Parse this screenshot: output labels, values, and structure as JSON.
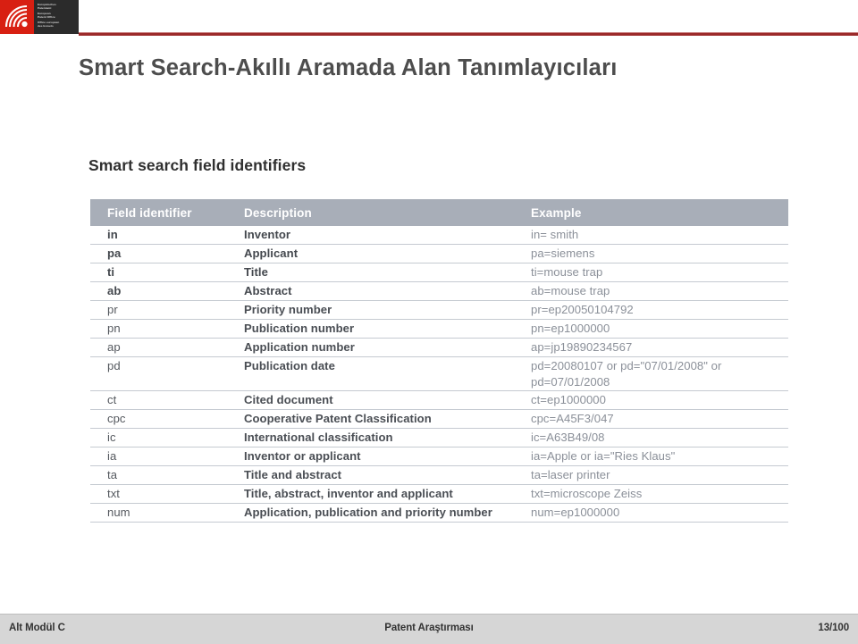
{
  "header": {
    "logo": {
      "mark_icon": "epo-swirl-icon",
      "mark_color": "#d81f12",
      "panel_color": "#2b2b2b",
      "lines": [
        "Europäisches",
        "Patentamt",
        "European",
        "Patent Office",
        "Office européen",
        "des brevets"
      ]
    },
    "rule_color": "#9c2a2a"
  },
  "title": "Smart Search-Akıllı Aramada Alan Tanımlayıcıları",
  "section_heading": "Smart search field identifiers",
  "table": {
    "header_bg": "#a8aeb8",
    "columns": [
      "Field identifier",
      "Description",
      "Example"
    ],
    "rows": [
      {
        "identifier": "in",
        "description": "Inventor",
        "example": "in= smith",
        "example2": ""
      },
      {
        "identifier": "pa",
        "description": "Applicant",
        "example": "pa=siemens",
        "example2": ""
      },
      {
        "identifier": "ti",
        "description": "Title",
        "example": "ti=mouse trap",
        "example2": ""
      },
      {
        "identifier": "ab",
        "description": "Abstract",
        "example": "ab=mouse trap",
        "example2": ""
      },
      {
        "identifier": "pr",
        "description": "Priority number",
        "example": "pr=ep20050104792",
        "example2": ""
      },
      {
        "identifier": "pn",
        "description": "Publication number",
        "example": "pn=ep1000000",
        "example2": ""
      },
      {
        "identifier": "ap",
        "description": "Application number",
        "example": "ap=jp19890234567",
        "example2": ""
      },
      {
        "identifier": "pd",
        "description": "Publication date",
        "example": "pd=20080107 or pd=\"07/01/2008\" or",
        "example2": "pd=07/01/2008"
      },
      {
        "identifier": "ct",
        "description": "Cited document",
        "example": "ct=ep1000000",
        "example2": ""
      },
      {
        "identifier": "cpc",
        "description": "Cooperative Patent Classification",
        "example": "cpc=A45F3/047",
        "example2": ""
      },
      {
        "identifier": "ic",
        "description": "International classification",
        "example": "ic=A63B49/08",
        "example2": ""
      },
      {
        "identifier": "ia",
        "description": "Inventor or applicant",
        "example": "ia=Apple or ia=\"Ries Klaus\"",
        "example2": ""
      },
      {
        "identifier": "ta",
        "description": "Title and abstract",
        "example": "ta=laser printer",
        "example2": ""
      },
      {
        "identifier": "txt",
        "description": "Title, abstract, inventor and applicant",
        "example": "txt=microscope Zeiss",
        "example2": ""
      },
      {
        "identifier": "num",
        "description": "Application, publication and priority number",
        "example": "num=ep1000000",
        "example2": ""
      }
    ]
  },
  "footer": {
    "left": "Alt Modül C",
    "center": "Patent Araştırması",
    "right": "13/100",
    "bg": "#d6d6d6"
  }
}
